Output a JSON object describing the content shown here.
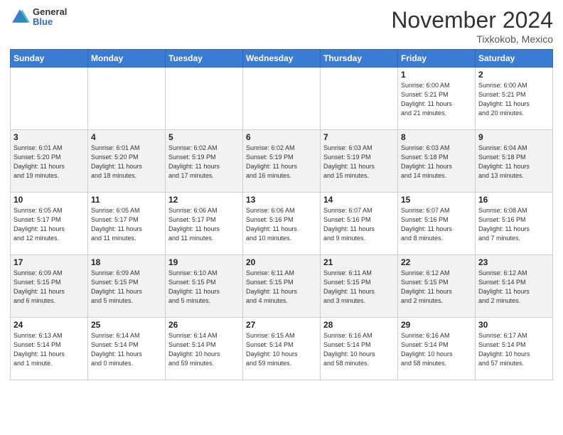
{
  "header": {
    "logo_general": "General",
    "logo_blue": "Blue",
    "month": "November 2024",
    "location": "Tixkokob, Mexico"
  },
  "days_of_week": [
    "Sunday",
    "Monday",
    "Tuesday",
    "Wednesday",
    "Thursday",
    "Friday",
    "Saturday"
  ],
  "weeks": [
    [
      {
        "day": "",
        "info": ""
      },
      {
        "day": "",
        "info": ""
      },
      {
        "day": "",
        "info": ""
      },
      {
        "day": "",
        "info": ""
      },
      {
        "day": "",
        "info": ""
      },
      {
        "day": "1",
        "info": "Sunrise: 6:00 AM\nSunset: 5:21 PM\nDaylight: 11 hours\nand 21 minutes."
      },
      {
        "day": "2",
        "info": "Sunrise: 6:00 AM\nSunset: 5:21 PM\nDaylight: 11 hours\nand 20 minutes."
      }
    ],
    [
      {
        "day": "3",
        "info": "Sunrise: 6:01 AM\nSunset: 5:20 PM\nDaylight: 11 hours\nand 19 minutes."
      },
      {
        "day": "4",
        "info": "Sunrise: 6:01 AM\nSunset: 5:20 PM\nDaylight: 11 hours\nand 18 minutes."
      },
      {
        "day": "5",
        "info": "Sunrise: 6:02 AM\nSunset: 5:19 PM\nDaylight: 11 hours\nand 17 minutes."
      },
      {
        "day": "6",
        "info": "Sunrise: 6:02 AM\nSunset: 5:19 PM\nDaylight: 11 hours\nand 16 minutes."
      },
      {
        "day": "7",
        "info": "Sunrise: 6:03 AM\nSunset: 5:19 PM\nDaylight: 11 hours\nand 15 minutes."
      },
      {
        "day": "8",
        "info": "Sunrise: 6:03 AM\nSunset: 5:18 PM\nDaylight: 11 hours\nand 14 minutes."
      },
      {
        "day": "9",
        "info": "Sunrise: 6:04 AM\nSunset: 5:18 PM\nDaylight: 11 hours\nand 13 minutes."
      }
    ],
    [
      {
        "day": "10",
        "info": "Sunrise: 6:05 AM\nSunset: 5:17 PM\nDaylight: 11 hours\nand 12 minutes."
      },
      {
        "day": "11",
        "info": "Sunrise: 6:05 AM\nSunset: 5:17 PM\nDaylight: 11 hours\nand 11 minutes."
      },
      {
        "day": "12",
        "info": "Sunrise: 6:06 AM\nSunset: 5:17 PM\nDaylight: 11 hours\nand 11 minutes."
      },
      {
        "day": "13",
        "info": "Sunrise: 6:06 AM\nSunset: 5:16 PM\nDaylight: 11 hours\nand 10 minutes."
      },
      {
        "day": "14",
        "info": "Sunrise: 6:07 AM\nSunset: 5:16 PM\nDaylight: 11 hours\nand 9 minutes."
      },
      {
        "day": "15",
        "info": "Sunrise: 6:07 AM\nSunset: 5:16 PM\nDaylight: 11 hours\nand 8 minutes."
      },
      {
        "day": "16",
        "info": "Sunrise: 6:08 AM\nSunset: 5:16 PM\nDaylight: 11 hours\nand 7 minutes."
      }
    ],
    [
      {
        "day": "17",
        "info": "Sunrise: 6:09 AM\nSunset: 5:15 PM\nDaylight: 11 hours\nand 6 minutes."
      },
      {
        "day": "18",
        "info": "Sunrise: 6:09 AM\nSunset: 5:15 PM\nDaylight: 11 hours\nand 5 minutes."
      },
      {
        "day": "19",
        "info": "Sunrise: 6:10 AM\nSunset: 5:15 PM\nDaylight: 11 hours\nand 5 minutes."
      },
      {
        "day": "20",
        "info": "Sunrise: 6:11 AM\nSunset: 5:15 PM\nDaylight: 11 hours\nand 4 minutes."
      },
      {
        "day": "21",
        "info": "Sunrise: 6:11 AM\nSunset: 5:15 PM\nDaylight: 11 hours\nand 3 minutes."
      },
      {
        "day": "22",
        "info": "Sunrise: 6:12 AM\nSunset: 5:15 PM\nDaylight: 11 hours\nand 2 minutes."
      },
      {
        "day": "23",
        "info": "Sunrise: 6:12 AM\nSunset: 5:14 PM\nDaylight: 11 hours\nand 2 minutes."
      }
    ],
    [
      {
        "day": "24",
        "info": "Sunrise: 6:13 AM\nSunset: 5:14 PM\nDaylight: 11 hours\nand 1 minute."
      },
      {
        "day": "25",
        "info": "Sunrise: 6:14 AM\nSunset: 5:14 PM\nDaylight: 11 hours\nand 0 minutes."
      },
      {
        "day": "26",
        "info": "Sunrise: 6:14 AM\nSunset: 5:14 PM\nDaylight: 10 hours\nand 59 minutes."
      },
      {
        "day": "27",
        "info": "Sunrise: 6:15 AM\nSunset: 5:14 PM\nDaylight: 10 hours\nand 59 minutes."
      },
      {
        "day": "28",
        "info": "Sunrise: 6:16 AM\nSunset: 5:14 PM\nDaylight: 10 hours\nand 58 minutes."
      },
      {
        "day": "29",
        "info": "Sunrise: 6:16 AM\nSunset: 5:14 PM\nDaylight: 10 hours\nand 58 minutes."
      },
      {
        "day": "30",
        "info": "Sunrise: 6:17 AM\nSunset: 5:14 PM\nDaylight: 10 hours\nand 57 minutes."
      }
    ]
  ]
}
